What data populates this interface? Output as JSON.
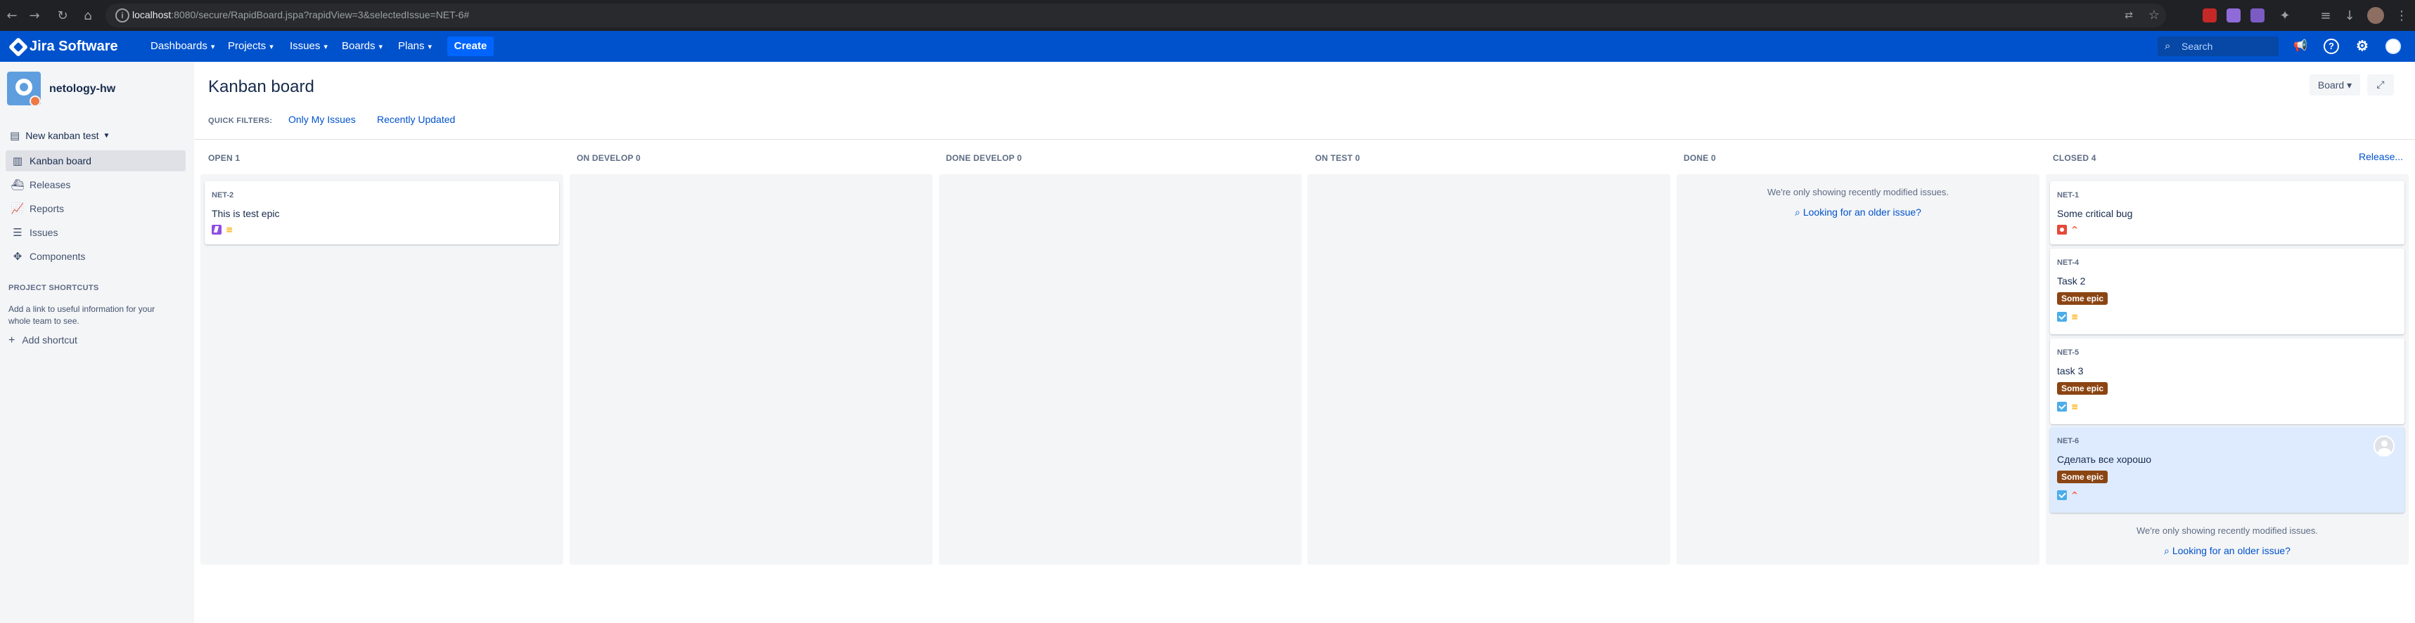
{
  "browser": {
    "url_host": "localhost",
    "url_path": ":8080/secure/RapidBoard.jspa?rapidView=3&selectedIssue=NET-6#"
  },
  "nav": {
    "logo": "Jira Software",
    "items": [
      "Dashboards",
      "Projects",
      "Issues",
      "Boards",
      "Plans"
    ],
    "create": "Create",
    "search_placeholder": "Search"
  },
  "sidebar": {
    "project_name": "netology-hw",
    "board_switch": "New kanban test",
    "items": [
      {
        "label": "Kanban board",
        "icon": "board-icon",
        "active": true
      },
      {
        "label": "Releases",
        "icon": "ship-icon"
      },
      {
        "label": "Reports",
        "icon": "chart-icon"
      },
      {
        "label": "Issues",
        "icon": "issues-icon"
      },
      {
        "label": "Components",
        "icon": "puzzle-icon"
      }
    ],
    "shortcuts_title": "PROJECT SHORTCUTS",
    "shortcuts_help": "Add a link to useful information for your whole team to see.",
    "add_shortcut": "Add shortcut"
  },
  "main": {
    "title": "Kanban board",
    "board_button": "Board",
    "quick_filters_label": "QUICK FILTERS:",
    "quick_filters": [
      "Only My Issues",
      "Recently Updated"
    ],
    "release_link": "Release...",
    "note": "We're only showing recently modified issues.",
    "older_link": "Looking for an older issue?",
    "columns": [
      {
        "name": "OPEN",
        "count": "1"
      },
      {
        "name": "ON DEVELOP",
        "count": "0"
      },
      {
        "name": "DONE DEVELOP",
        "count": "0"
      },
      {
        "name": "ON TEST",
        "count": "0"
      },
      {
        "name": "DONE",
        "count": "0"
      },
      {
        "name": "CLOSED",
        "count": "4"
      }
    ],
    "cards": {
      "net2": {
        "key": "NET-2",
        "summary": "This is test epic",
        "type": "epic",
        "priority": "medium"
      },
      "net1": {
        "key": "NET-1",
        "summary": "Some critical bug",
        "type": "bug",
        "priority": "high"
      },
      "net4": {
        "key": "NET-4",
        "summary": "Task 2",
        "epic": "Some epic",
        "type": "task",
        "priority": "medium"
      },
      "net5": {
        "key": "NET-5",
        "summary": "task 3",
        "epic": "Some epic",
        "type": "task",
        "priority": "medium"
      },
      "net6": {
        "key": "NET-6",
        "summary": "Сделать все хорошо",
        "epic": "Some epic",
        "type": "task",
        "priority": "high",
        "selected": true
      }
    },
    "colors": {
      "accent": "#0052cc",
      "epic_label": "#8b4513"
    }
  }
}
